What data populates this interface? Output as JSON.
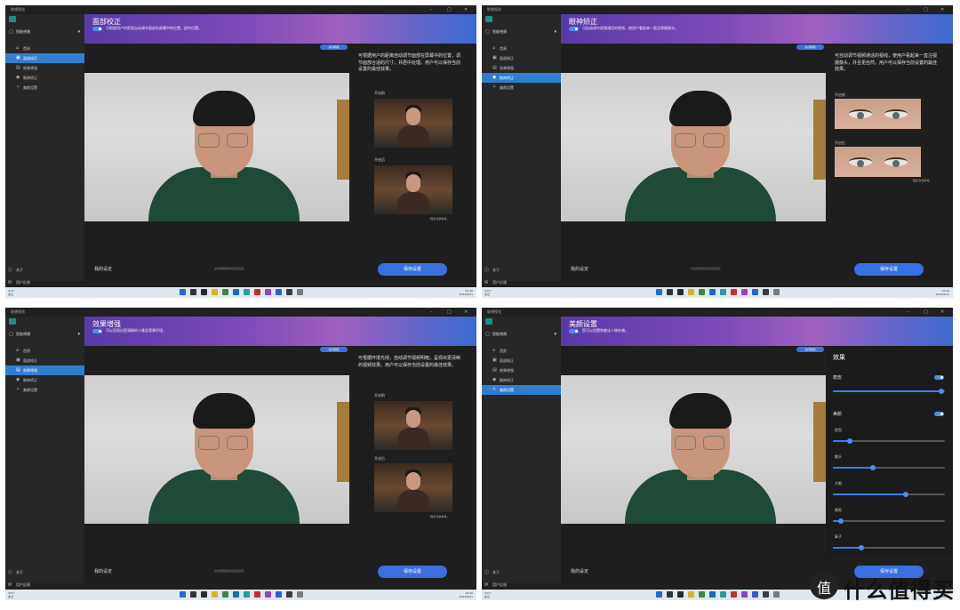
{
  "window_title": "联想视觉",
  "sidebar": {
    "section": "智能視頻",
    "items": [
      {
        "label": "首頁",
        "icon": "home-icon"
      },
      {
        "label": "面部校正",
        "icon": "face-frame-icon"
      },
      {
        "label": "效果增强",
        "icon": "image-icon"
      },
      {
        "label": "眼神矫正",
        "icon": "eye-icon"
      },
      {
        "label": "美颜设置",
        "icon": "sparkle-icon"
      }
    ],
    "about": "关于",
    "feedback": "用户反馈"
  },
  "panels": [
    {
      "id": "q1",
      "active_index": 1,
      "title": "面部校正",
      "desc": "可根据用户的距离自动调节面部在屏幕中的位置，居中位置。",
      "panel_text": "可根据用户的距离自动调节面部在屏幕中的位置，调节面部合适的尺寸，并居中处理。用户可以保存当前设置的最佳效果。",
      "before_label": "开启前",
      "after_label": "开启后",
      "footnote": "*图片仅供参考。"
    },
    {
      "id": "q2",
      "active_index": 3,
      "title": "眼神矫正",
      "desc": "可自动调节视频通话的视线，使用户看起来一直注视摄像头。",
      "panel_text": "可自动调节视频通话的视线，使用户看起来一直注视摄像头，并且更自然，用户可以保存当前设置的最佳效果。",
      "before_label": "开启前",
      "after_label": "开启后",
      "footnote": "*图片仅供参考。"
    },
    {
      "id": "q3",
      "active_index": 2,
      "title": "效果增强",
      "desc": "可以呈现出更清晰的人像及背景环境。",
      "panel_text": "可根据环境光线，自动调节视频明暗，呈现出更清晰的视频效果。用户可以保存当前设置的最佳效果。",
      "before_label": "开启前",
      "after_label": "开启后",
      "footnote": "*图片仅供参考。"
    },
    {
      "id": "q4",
      "active_index": 4,
      "title": "美颜设置",
      "desc": "您可以设置和美化人物外貌。"
    }
  ],
  "close_effect": "关闭视频",
  "bottom": {
    "my_settings": "我的设定",
    "hint": "点击按钮保存并应用设置。",
    "save": "保存设置"
  },
  "effects": {
    "title": "效果",
    "smooth": "磨皮",
    "beauty": "美颜",
    "rows": [
      "脸型",
      "额头",
      "大眼",
      "眼距",
      "鼻子"
    ],
    "smooth_level": 0.97,
    "row_levels": [
      0.15,
      0.36,
      0.65,
      0.07,
      0.25
    ]
  },
  "taskbar": {
    "weather": "23°C",
    "weather_sub": "多云",
    "time": "15:40",
    "date": "2022/6/21"
  },
  "watermark": "什么值得买",
  "colors": {
    "accent": "#3a6fe0",
    "active": "#2f7fd0"
  }
}
